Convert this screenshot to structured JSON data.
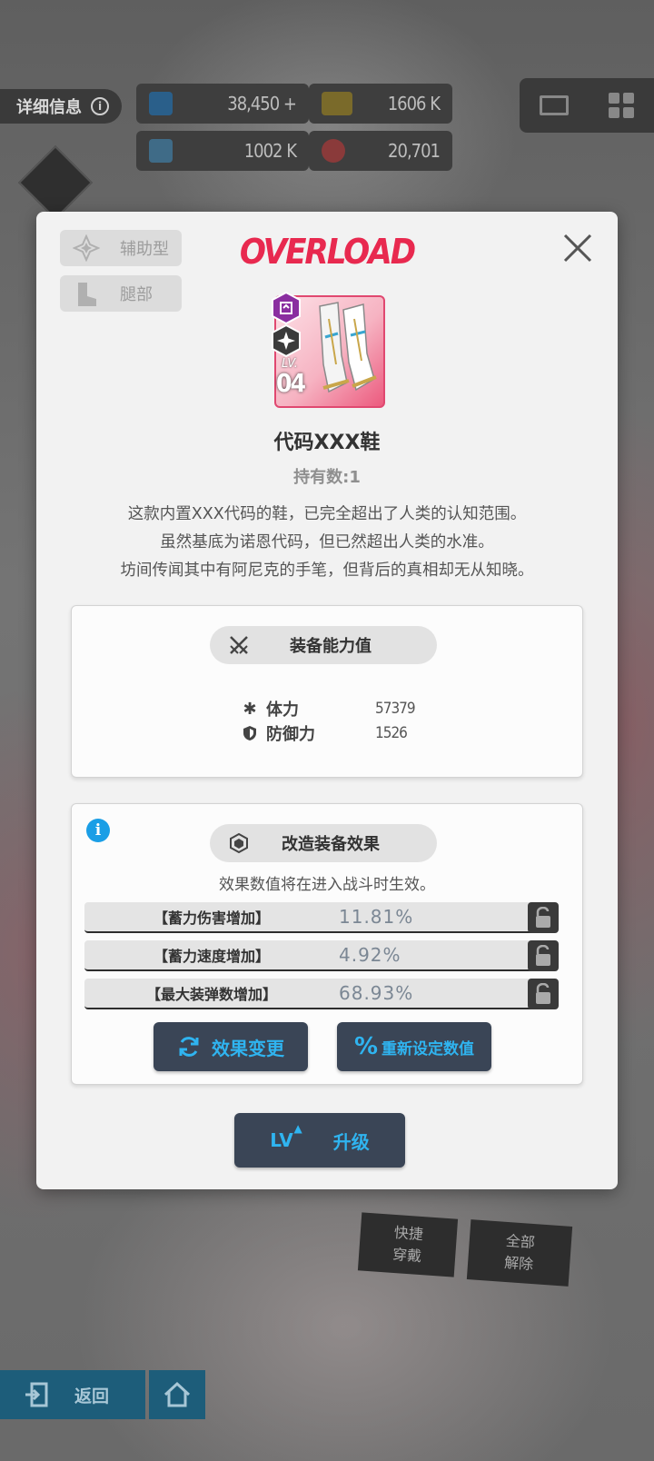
{
  "background": {
    "detail_tab": "详细信息",
    "resources": [
      {
        "name": "blue-crystal",
        "value": "38,450",
        "plus": "+"
      },
      {
        "name": "battery",
        "value": "1606 K"
      },
      {
        "name": "core-capsule",
        "value": "1002 K"
      },
      {
        "name": "red-orb",
        "value": "20,701"
      }
    ],
    "quick_equip": "快捷\n穿戴",
    "unequip_all": "全部\n解除",
    "back_label": "返回"
  },
  "modal": {
    "brand": "OVERLOAD",
    "tags": [
      {
        "label": "辅助型",
        "icon": "support-class-icon"
      },
      {
        "label": "腿部",
        "icon": "boots-slot-icon"
      }
    ],
    "item": {
      "lv_label": "LV.",
      "level": "04",
      "name": "代码XXX鞋",
      "count": "持有数:1",
      "desc_lines": [
        "这款内置XXX代码的鞋，已完全超出了人类的认知范围。",
        "虽然基底为诺恩代码，但已然超出人类的水准。",
        "坊间传闻其中有阿尼克的手笔，但背后的真相却无从知晓。"
      ]
    },
    "stats_panel": {
      "title": "装备能力值",
      "stats": [
        {
          "label": "体力",
          "value": "57379",
          "icon": "hp-asterisk-icon"
        },
        {
          "label": "防御力",
          "value": "1526",
          "icon": "shield-icon"
        }
      ]
    },
    "effects_panel": {
      "title": "改造装备效果",
      "note": "效果数值将在进入战斗时生效。",
      "effects": [
        {
          "name": "【蓄力伤害增加】",
          "value": "11.81%"
        },
        {
          "name": "【蓄力速度增加】",
          "value": "4.92%"
        },
        {
          "name": "【最大装弹数增加】",
          "value": "68.93%"
        }
      ],
      "change_button": "效果变更",
      "reset_button": "重新设定数值"
    },
    "upgrade": {
      "lv": "LV",
      "label": "升级"
    },
    "colors": {
      "accent": "#2fb4f0",
      "brand": "#e8294f",
      "info": "#1a9ee6"
    }
  }
}
